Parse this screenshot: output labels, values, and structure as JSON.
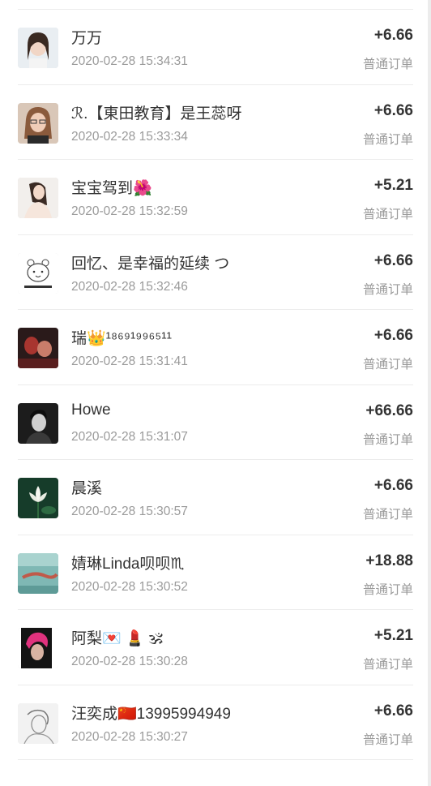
{
  "orders": [
    {
      "name": "万万",
      "time": "2020-02-28 15:34:31",
      "amount": "+6.66",
      "type": "普通订单",
      "avatar": "portrait-woman-icon"
    },
    {
      "name": "ℛ.【東田教育】是王蕊呀",
      "time": "2020-02-28 15:33:34",
      "amount": "+6.66",
      "type": "普通订单",
      "avatar": "portrait-woman-glasses-icon"
    },
    {
      "name": "宝宝驾到🌺",
      "time": "2020-02-28 15:32:59",
      "amount": "+5.21",
      "type": "普通订单",
      "avatar": "portrait-woman-pose-icon"
    },
    {
      "name": "回忆、是幸福的延续 つ",
      "time": "2020-02-28 15:32:46",
      "amount": "+6.66",
      "type": "普通订单",
      "avatar": "cartoon-bear-icon"
    },
    {
      "name": "瑞👑¹⁸⁶⁹¹⁹⁹⁶⁵¹¹",
      "time": "2020-02-28 15:31:41",
      "amount": "+6.66",
      "type": "普通订单",
      "avatar": "couple-photo-icon"
    },
    {
      "name": "Howe",
      "time": "2020-02-28 15:31:07",
      "amount": "+66.66",
      "type": "普通订单",
      "avatar": "portrait-man-bw-icon"
    },
    {
      "name": "晨溪",
      "time": "2020-02-28 15:30:57",
      "amount": "+6.66",
      "type": "普通订单",
      "avatar": "lotus-flower-icon"
    },
    {
      "name": "婧琳Linda呗呗♏",
      "time": "2020-02-28 15:30:52",
      "amount": "+18.88",
      "type": "普通订单",
      "avatar": "underwater-scene-icon"
    },
    {
      "name": "阿梨💌 💄 🕉",
      "time": "2020-02-28 15:30:28",
      "amount": "+5.21",
      "type": "普通订单",
      "avatar": "pink-hair-portrait-icon"
    },
    {
      "name": "汪奕成🇨🇳13995994949",
      "time": "2020-02-28 15:30:27",
      "amount": "+6.66",
      "type": "普通订单",
      "avatar": "sketch-portrait-icon"
    }
  ]
}
